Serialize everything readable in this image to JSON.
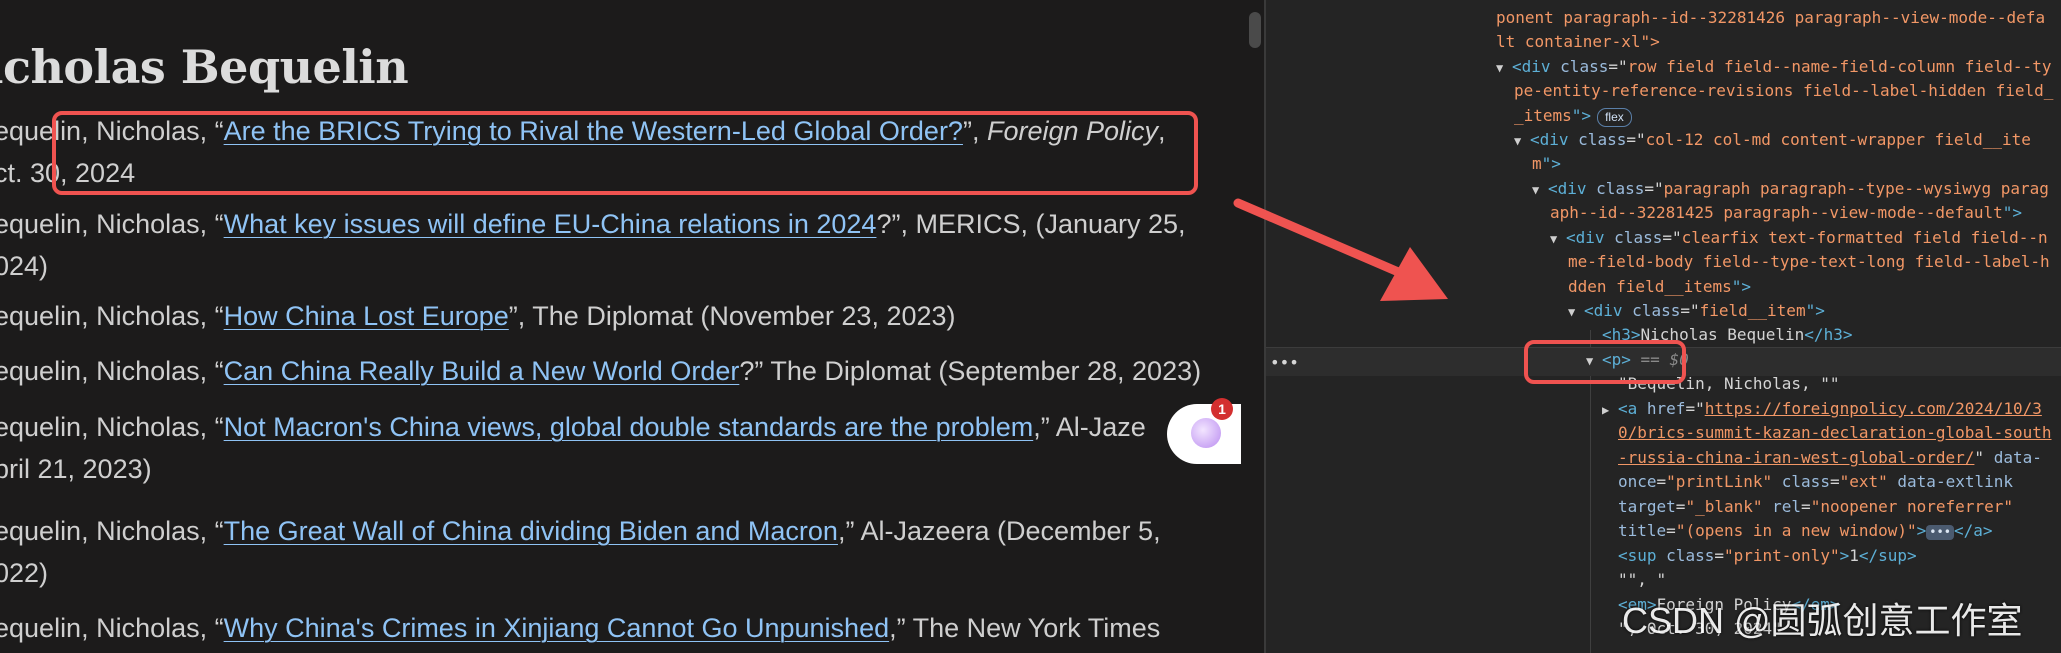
{
  "article": {
    "title": "icholas Bequelin",
    "entries": [
      {
        "pre": "equelin, Nicholas, “",
        "link": "Are the BRICS Trying to Rival the Western-Led Global Order?",
        "post": "”, ",
        "em": "Foreign Policy",
        "post2": ",",
        "line2": "ct. 30, 2024"
      },
      {
        "pre": "equelin, Nicholas, “",
        "link": "What key issues will define EU-China relations in 2024",
        "post": "?”, MERICS, (January 25,",
        "line2": "024)"
      },
      {
        "pre": "equelin, Nicholas, “",
        "link": "How China Lost Europe",
        "post": "”, The Diplomat (November 23, 2023)"
      },
      {
        "pre": "equelin, Nicholas, “",
        "link": "Can China Really Build a New World Order",
        "post": "?” The Diplomat (September 28, 2023)"
      },
      {
        "pre": "equelin, Nicholas, “",
        "link": "Not Macron's China views, global double standards are the problem",
        "post": ",” Al-Jaze",
        "line2": "pril 21, 2023)"
      },
      {
        "pre": "equelin, Nicholas, “",
        "link": "The Great Wall of China dividing Biden and Macron",
        "post": ",” Al-Jazeera (December 5,",
        "line2": "022)"
      },
      {
        "pre": "equelin, Nicholas, “",
        "link": "Why China's Crimes in Xinjiang Cannot Go Unpunished",
        "post": ",” The New York Times"
      }
    ]
  },
  "widget": {
    "badge": "1"
  },
  "devtools": {
    "l1": "ponent paragraph--id--32281426 paragraph--view-mode--defa",
    "l2": "lt container-xl\">",
    "row_div": {
      "tag": "<div ",
      "attr": "class",
      "eq": "=\"",
      "val": "row field field--name-field-column field--ty",
      "val2": "pe-entity-reference-revisions field--label-hidden field_",
      "val3": "_items",
      "close": "\">",
      "badge": "flex"
    },
    "col_div": {
      "tag": "<div ",
      "attr": "class",
      "val": "col-12 col-md content-wrapper field__ite",
      "val2": "m"
    },
    "para_div": {
      "tag": "<div ",
      "attr": "class",
      "val": "paragraph paragraph--type--wysiwyg parag",
      "val2": "aph--id--32281425 paragraph--view-mode--default"
    },
    "clear_div": {
      "tag": "<div ",
      "attr": "class",
      "val": "clearfix text-formatted field field--n",
      "val2": "me-field-body field--type-text-long field--label-h",
      "val3": "dden field__items"
    },
    "item_div": {
      "tag": "<div ",
      "attr": "class",
      "val": "field__item"
    },
    "h3": {
      "open": "<h3>",
      "text": "Nicholas Bequelin",
      "close": "</h3>"
    },
    "p": {
      "tag": "<p>",
      "sel": "== $0"
    },
    "text1": "\"Bequelin, Nicholas, \"\"",
    "a": {
      "tag": "<a ",
      "href_attr": "href",
      "href1": "https://foreignpolicy.com/2024/10/3",
      "href2": "0/brics-summit-kazan-declaration-global-south",
      "href3": "-russia-china-iran-west-global-order/",
      "data_attr": "data-",
      "l2a": "once",
      "l2v": "\"printLink\"",
      "class_attr": "class",
      "class_val": "\"ext\"",
      "ext_attr": "data-extlink",
      "target_attr": "target",
      "target_val": "\"_blank\"",
      "rel_attr": "rel",
      "rel_val": "\"noopener noreferrer\"",
      "title_attr": "title",
      "title_val": "\"(opens in a new window)\"",
      "ell": "•••",
      "close": "</a>"
    },
    "sup": {
      "open": "<sup ",
      "attr": "class",
      "val": "\"print-only\"",
      "text": "1",
      "close": "</sup>"
    },
    "text2": "\"\", \"",
    "em": {
      "open": "<em>",
      "text": "Foreign Policy",
      "close": "</em>"
    },
    "text3": "\", Oct. 30, 2024\""
  },
  "watermark": "CSDN @圆弧创意工作室"
}
